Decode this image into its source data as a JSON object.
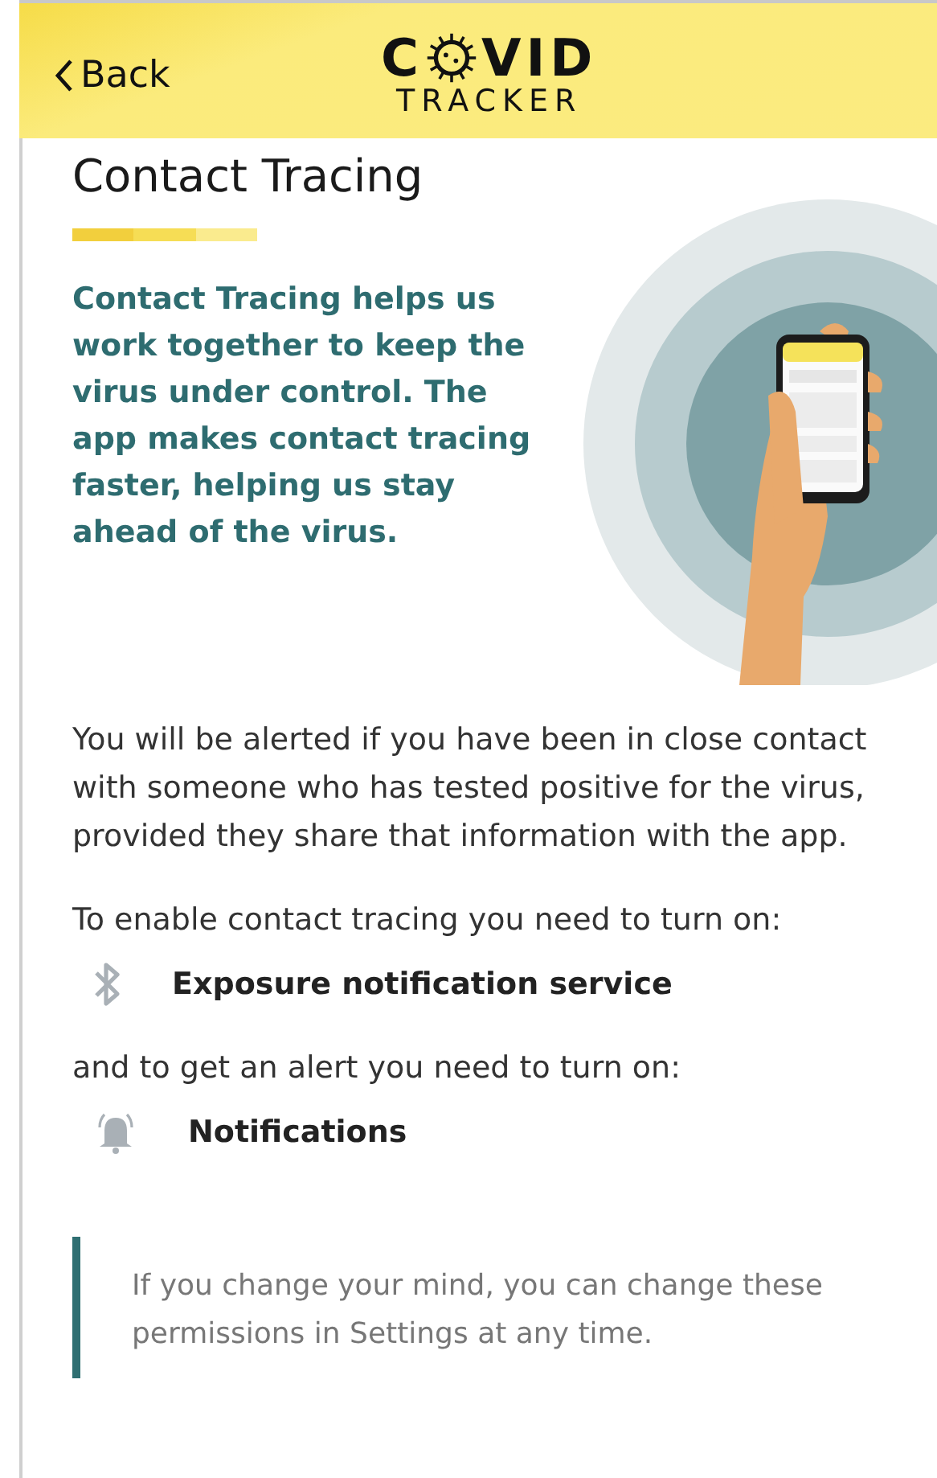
{
  "header": {
    "back": "Back",
    "logo_start": "C",
    "logo_end": "VID",
    "logo_subtitle": "TRACKER"
  },
  "title": "Contact Tracing",
  "intro": "Contact Tracing helps us work together to keep the virus under control. The app makes contact tracing faster, helping us stay ahead of the virus.",
  "body": "You will be alerted if you have been in close contact with someone who has tested positive for the virus, provided they share that information with the app.",
  "sections": [
    {
      "lead": "To enable contact tracing you need to turn on:",
      "permission": {
        "kind": "bluetooth",
        "label": "Exposure notification service"
      }
    },
    {
      "lead": "and to get an alert you need to turn on:",
      "permission": {
        "kind": "bell",
        "label": "Notifications"
      }
    }
  ],
  "note": "If you change your mind, you can change these permissions in Settings at any time."
}
